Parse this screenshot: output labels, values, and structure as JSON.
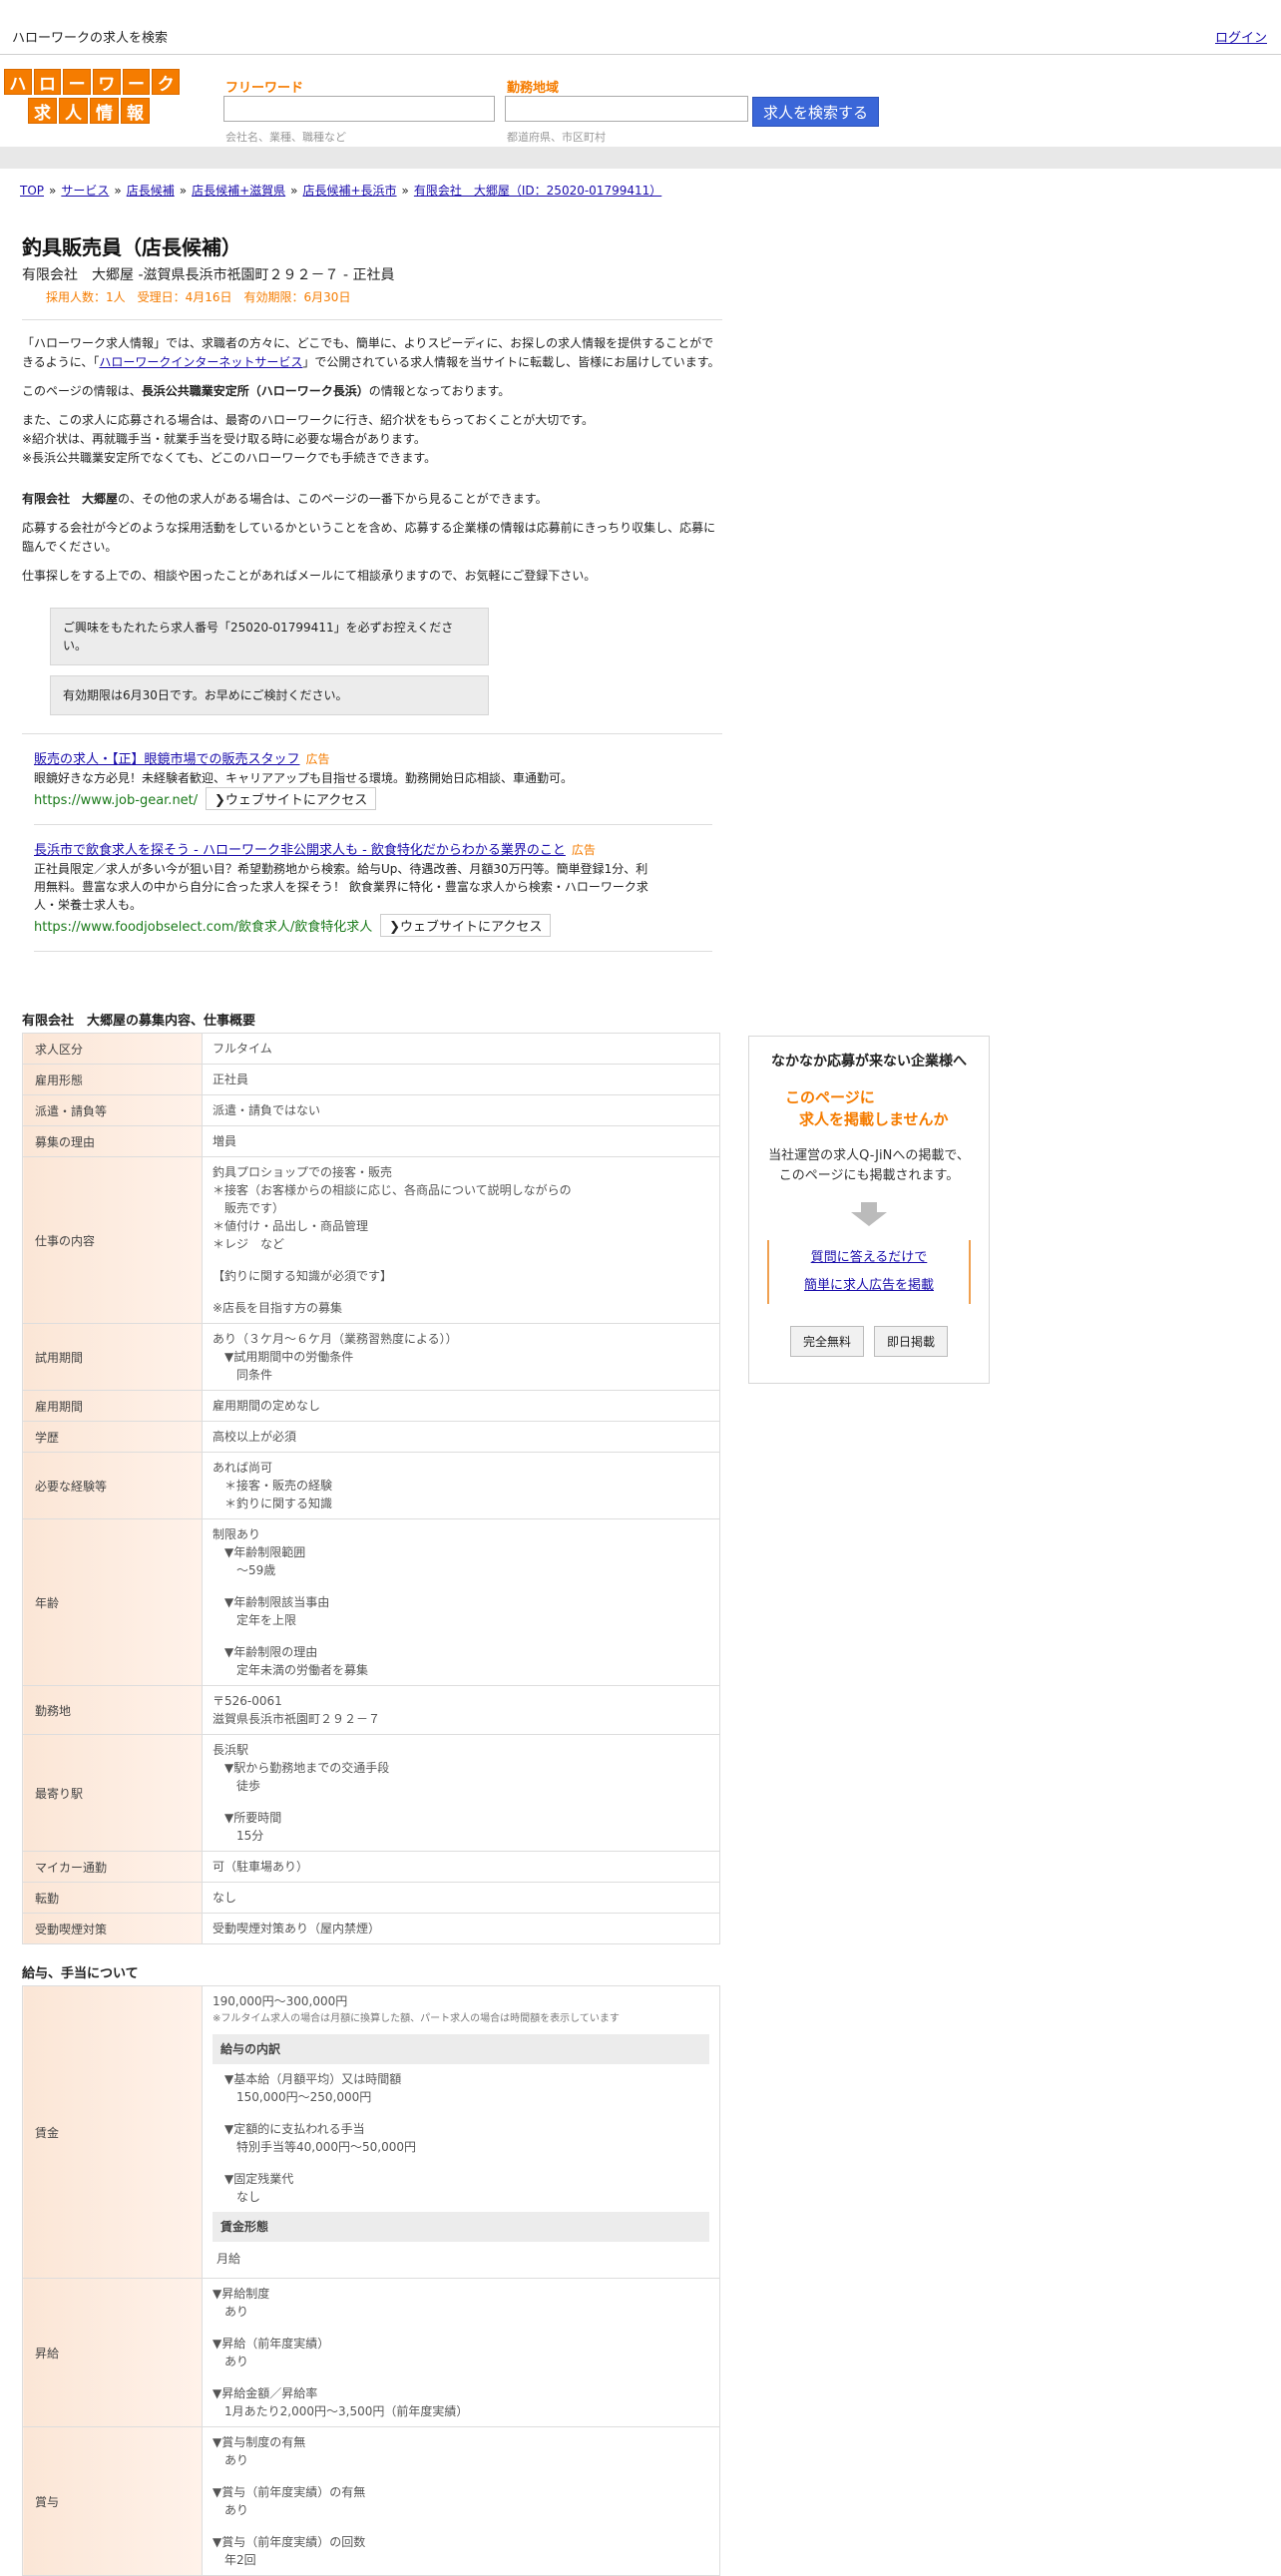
{
  "topbar": {
    "site_title": "ハローワークの求人を検索",
    "login": "ログイン"
  },
  "logo": {
    "row1": [
      "ハ",
      "ロ",
      "ー",
      "ワ",
      "ー",
      "ク"
    ],
    "row2": [
      "求",
      "人",
      "情",
      "報"
    ]
  },
  "search": {
    "freeword_label": "フリーワード",
    "freeword_hint": "会社名、業種、職種など",
    "area_label": "勤務地域",
    "area_hint": "都道府県、市区町村",
    "button": "求人を検索する"
  },
  "breadcrumb": [
    "TOP",
    "サービス",
    "店長候補",
    "店長候補+滋賀県",
    "店長候補+長浜市",
    "有限会社　大郷屋（ID：25020-01799411）"
  ],
  "job": {
    "title": "釣具販売員（店長候補）",
    "company_line": "有限会社　大郷屋 -滋賀県長浜市祇園町２９２－７ - 正社員",
    "sub_info": "採用人数：1人　受理日：4月16日　有効期限：6月30日"
  },
  "intro": {
    "p1_a": "「ハローワーク求人情報」では、求職者の方々に、どこでも、簡単に、よりスピーディに、お探しの求人情報を提供することができるように、「",
    "p1_link": "ハローワークインターネットサービス",
    "p1_b": "」で公開されている求人情報を当サイトに転載し、皆様にお届けしています。",
    "p2_a": "このページの情報は、",
    "p2_bold": "長浜公共職業安定所（ハローワーク長浜）",
    "p2_b": "の情報となっております。",
    "p3_l1": "また、この求人に応募される場合は、最寄のハローワークに行き、紹介状をもらっておくことが大切です。",
    "p3_l2": "※紹介状は、再就職手当・就業手当を受け取る時に必要な場合があります。",
    "p3_l3": "※長浜公共職業安定所でなくても、どこのハローワークでも手続きできます。",
    "p4_bold": "有限会社　大郷屋",
    "p4_b": "の、その他の求人がある場合は、このページの一番下から見ることができます。",
    "p5": "応募する会社が今どのような採用活動をしているかということを含め、応募する企業様の情報は応募前にきっちり収集し、応募に臨んでください。",
    "p6": "仕事探しをする上での、相談や困ったことがあればメールにて相談承りますので、お気軽にご登録下さい。",
    "notice1": "ご興味をもたれたら求人番号「25020-01799411」を必ずお控えください。",
    "notice2": "有効期限は6月30日です。お早めにご検討ください。"
  },
  "ads": [
    {
      "title": "販売の求人・【正】眼鏡市場での販売スタッフ",
      "tag": "広告",
      "desc": "眼鏡好きな方必見！未経験者歓迎、キャリアアップも目指せる環境。勤務開始日応相談、車通勤可。",
      "url": "https://www.job-gear.net/",
      "button": "ウェブサイトにアクセス"
    },
    {
      "title": "長浜市で飲食求人を探そう - ハローワーク非公開求人も - 飲食特化だからわかる業界のこと",
      "tag": "広告",
      "desc": "正社員限定／求人が多い今が狙い目？希望勤務地から検索。給与Up、待遇改善、月額30万円等。簡単登録1分、利用無料。豊富な求人の中から自分に合った求人を探そう！ 飲食業界に特化・豊富な求人から検索・ハローワーク求人・栄養士求人も。",
      "url": "https://www.foodjobselect.com/飲食求人/飲食特化求人",
      "button": "ウェブサイトにアクセス"
    }
  ],
  "recruit": {
    "title": "有限会社　大郷屋の募集内容、仕事概要",
    "rows": [
      {
        "label": "求人区分",
        "lines": [
          "フルタイム"
        ]
      },
      {
        "label": "雇用形態",
        "lines": [
          "正社員"
        ]
      },
      {
        "label": "派遣・請負等",
        "lines": [
          "派遣・請負ではない"
        ]
      },
      {
        "label": "募集の理由",
        "lines": [
          "増員"
        ]
      },
      {
        "label": "仕事の内容",
        "lines": [
          "釣具プロショップでの接客・販売",
          "＊接客（お客様からの相談に応じ、各商品について説明しながらの",
          "　販売です）",
          "＊値付け・品出し・商品管理",
          "＊レジ　など",
          "",
          "【釣りに関する知識が必須です】",
          "",
          "※店長を目指す方の募集"
        ]
      },
      {
        "label": "試用期間",
        "lines": [
          "あり（３ケ月～６ケ月（業務習熟度による））",
          "　▼試用期間中の労働条件",
          "　　同条件"
        ]
      },
      {
        "label": "雇用期間",
        "lines": [
          "雇用期間の定めなし"
        ]
      },
      {
        "label": "学歴",
        "lines": [
          "高校以上が必須"
        ]
      },
      {
        "label": "必要な経験等",
        "lines": [
          "あれば尚可",
          "　＊接客・販売の経験",
          "　＊釣りに関する知識"
        ]
      },
      {
        "label": "年齢",
        "lines": [
          "制限あり",
          "　▼年齢制限範囲",
          "　　～59歳",
          "",
          "　▼年齢制限該当事由",
          "　　定年を上限",
          "",
          "　▼年齢制限の理由",
          "　　定年未満の労働者を募集"
        ]
      },
      {
        "label": "勤務地",
        "lines": [
          "〒526-0061",
          "滋賀県長浜市祇園町２９２－７"
        ]
      },
      {
        "label": "最寄り駅",
        "lines": [
          "長浜駅",
          "　▼駅から勤務地までの交通手段",
          "　　徒歩",
          "",
          "　▼所要時間",
          "　　15分"
        ]
      },
      {
        "label": "マイカー通勤",
        "lines": [
          "可（駐車場あり）"
        ]
      },
      {
        "label": "転勤",
        "lines": [
          "なし"
        ]
      },
      {
        "label": "受動喫煙対策",
        "lines": [
          "受動喫煙対策あり（屋内禁煙）"
        ]
      }
    ]
  },
  "salary": {
    "title": "給与、手当について",
    "wage_label": "賃金",
    "wage_range": "190,000円〜300,000円",
    "wage_note": "※フルタイム求人の場合は月額に換算した額、パート求人の場合は時間額を表示しています",
    "breakdown_title": "給与の内訳",
    "breakdown_lines": [
      "　▼基本給（月額平均）又は時間額",
      "　　150,000円〜250,000円",
      "",
      "　▼定額的に支払われる手当",
      "　　特別手当等40,000円〜50,000円",
      "",
      "　▼固定残業代",
      "　　なし"
    ],
    "form_title": "賃金形態",
    "form_value": "月給",
    "raise_label": "昇給",
    "raise_lines": [
      "▼昇給制度",
      "　あり",
      "",
      "▼昇給（前年度実績）",
      "　あり",
      "",
      "▼昇給金額／昇給率",
      "　1月あたり2,000円〜3,500円（前年度実績）"
    ],
    "bonus_label": "賞与",
    "bonus_lines": [
      "▼賞与制度の有無",
      "　あり",
      "",
      "▼賞与（前年度実績）の有無",
      "　あり",
      "",
      "▼賞与（前年度実績）の回数",
      "　年2回"
    ]
  },
  "side": {
    "title": "なかなか応募が来ない企業様へ",
    "catch_l1": "このページに",
    "catch_l2": "求人を掲載しませんか",
    "desc_l1": "当社運営の求人Q-JiNへの掲載で、",
    "desc_l2": "このページにも掲載されます。",
    "link1": "質問に答えるだけで",
    "link2": "簡単に求人広告を掲載",
    "badge1": "完全無料",
    "badge2": "即日掲載"
  }
}
